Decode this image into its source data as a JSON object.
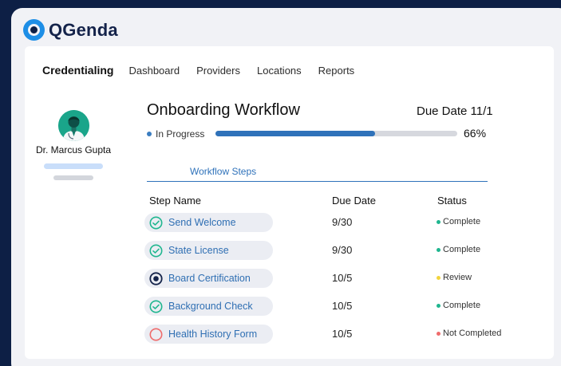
{
  "brand": {
    "name": "QGenda"
  },
  "nav": {
    "title": "Credentialing",
    "links": [
      "Dashboard",
      "Providers",
      "Locations",
      "Reports"
    ]
  },
  "provider": {
    "name": "Dr. Marcus Gupta"
  },
  "workflow": {
    "title": "Onboarding Workflow",
    "due": "Due Date 11/1",
    "status": "In Progress",
    "progress_percent": 66,
    "progress_label": "66%",
    "tab": "Workflow Steps"
  },
  "table": {
    "headers": {
      "step": "Step Name",
      "due": "Due Date",
      "status": "Status"
    },
    "rows": [
      {
        "step": "Send Welcome",
        "due": "9/30",
        "status": "Complete",
        "icon": "check-circle-icon"
      },
      {
        "step": "State License",
        "due": "9/30",
        "status": "Complete",
        "icon": "check-circle-icon"
      },
      {
        "step": "Board Certification",
        "due": "10/5",
        "status": "Review",
        "icon": "in-review-circle-icon"
      },
      {
        "step": "Background Check",
        "due": "10/5",
        "status": "Complete",
        "icon": "check-circle-icon"
      },
      {
        "step": "Health History Form",
        "due": "10/5",
        "status": "Not Completed",
        "icon": "empty-circle-icon"
      }
    ]
  },
  "colors": {
    "background": "#0d1f45",
    "accent": "#2f72ba",
    "complete": "#1fb68f",
    "review": "#f2d43d",
    "not_completed": "#ef6b6b"
  }
}
